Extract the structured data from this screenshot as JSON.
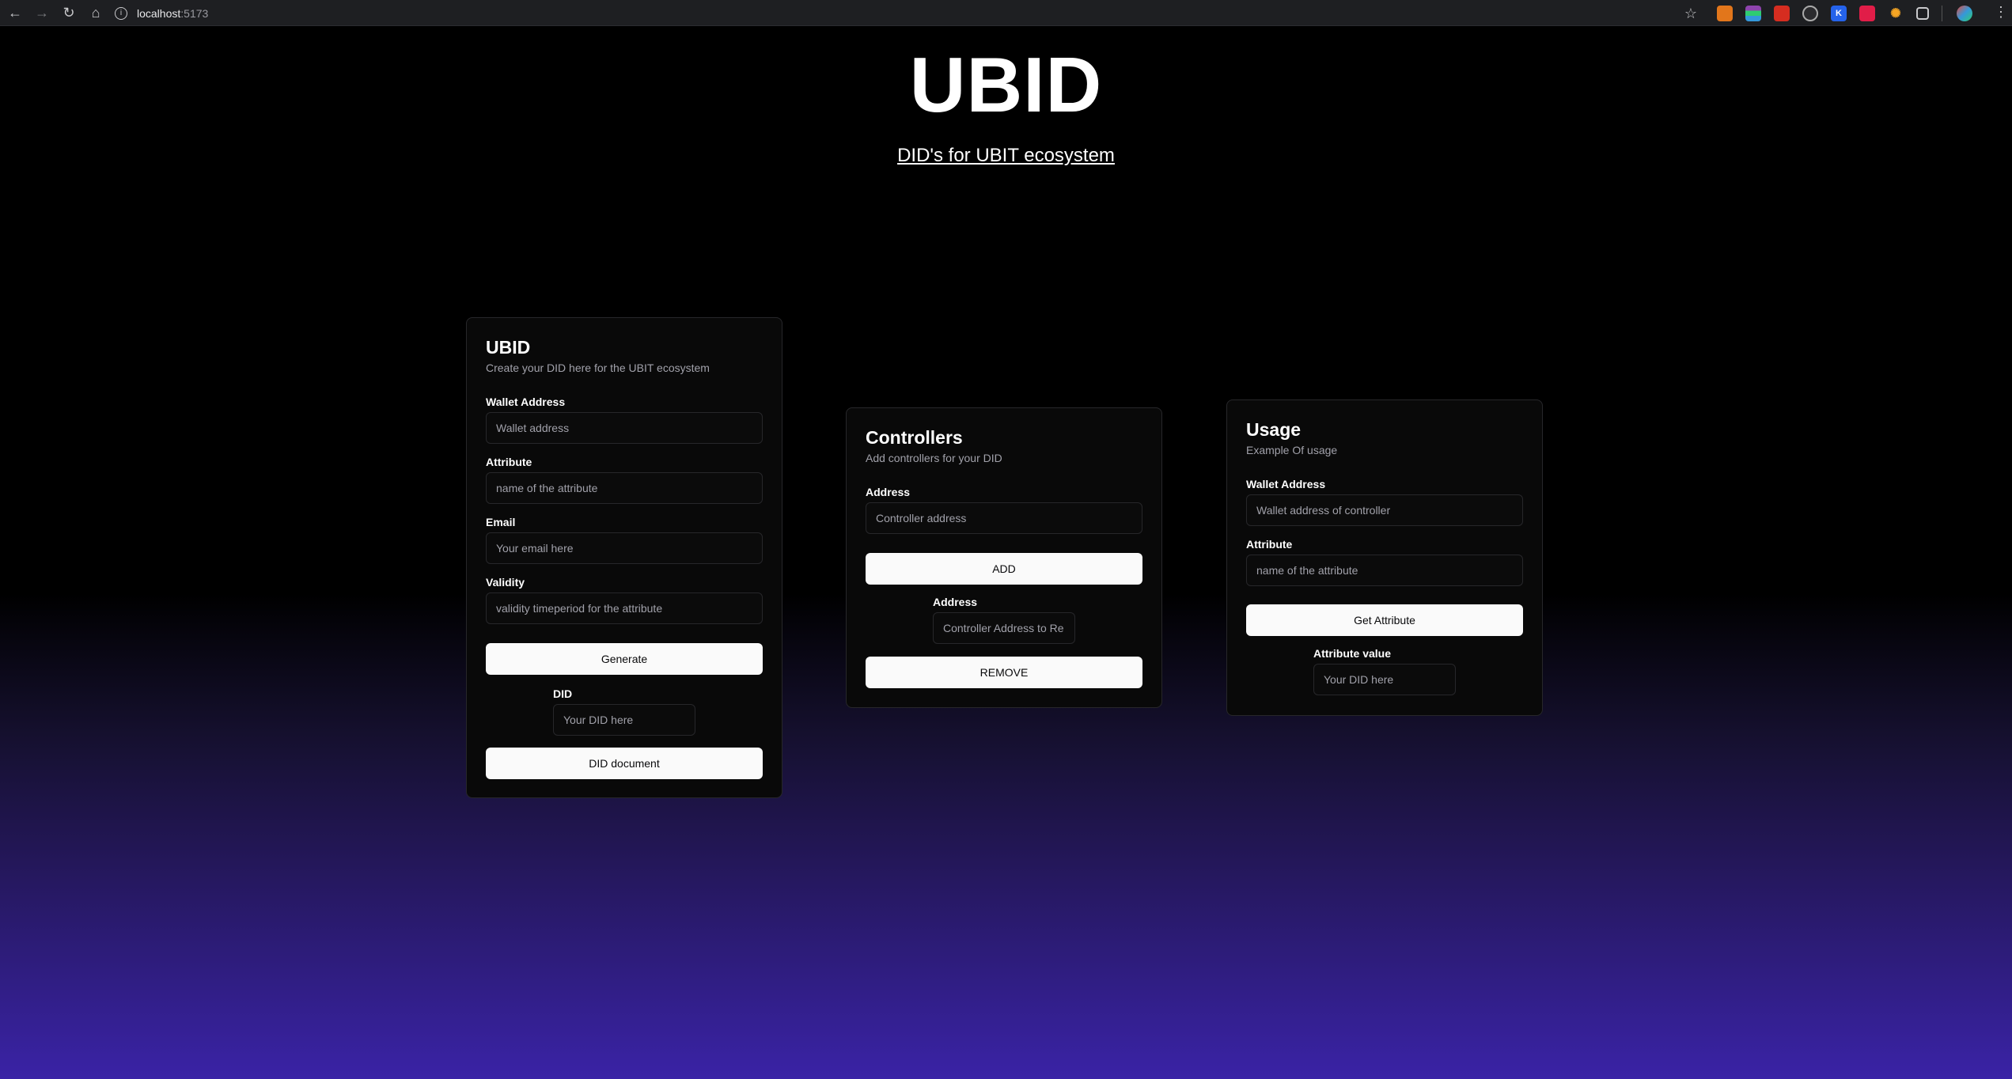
{
  "browser": {
    "url_host": "localhost",
    "url_port": ":5173"
  },
  "hero": {
    "title": "UBID",
    "subtitle": "DID's for UBIT ecosystem"
  },
  "create_card": {
    "title": "UBID",
    "description": "Create your DID here for the UBIT ecosystem",
    "wallet_label": "Wallet Address",
    "wallet_placeholder": "Wallet address",
    "attribute_label": "Attribute",
    "attribute_placeholder": "name of the attribute",
    "email_label": "Email",
    "email_placeholder": "Your email here",
    "validity_label": "Validity",
    "validity_placeholder": "validity timeperiod for the attribute",
    "generate_button": "Generate",
    "did_label": "DID",
    "did_placeholder": "Your DID here",
    "did_document_button": "DID document"
  },
  "controllers_card": {
    "title": "Controllers",
    "description": "Add controllers for your DID",
    "address_label": "Address",
    "address_placeholder": "Controller address",
    "add_button": "ADD",
    "remove_address_label": "Address",
    "remove_address_placeholder": "Controller Address to Re",
    "remove_button": "REMOVE"
  },
  "usage_card": {
    "title": "Usage",
    "description": "Example Of usage",
    "wallet_label": "Wallet Address",
    "wallet_placeholder": "Wallet address of controller",
    "attribute_label": "Attribute",
    "attribute_placeholder": "name of the attribute",
    "get_button": "Get Attribute",
    "value_label": "Attribute value",
    "value_placeholder": "Your DID here"
  }
}
